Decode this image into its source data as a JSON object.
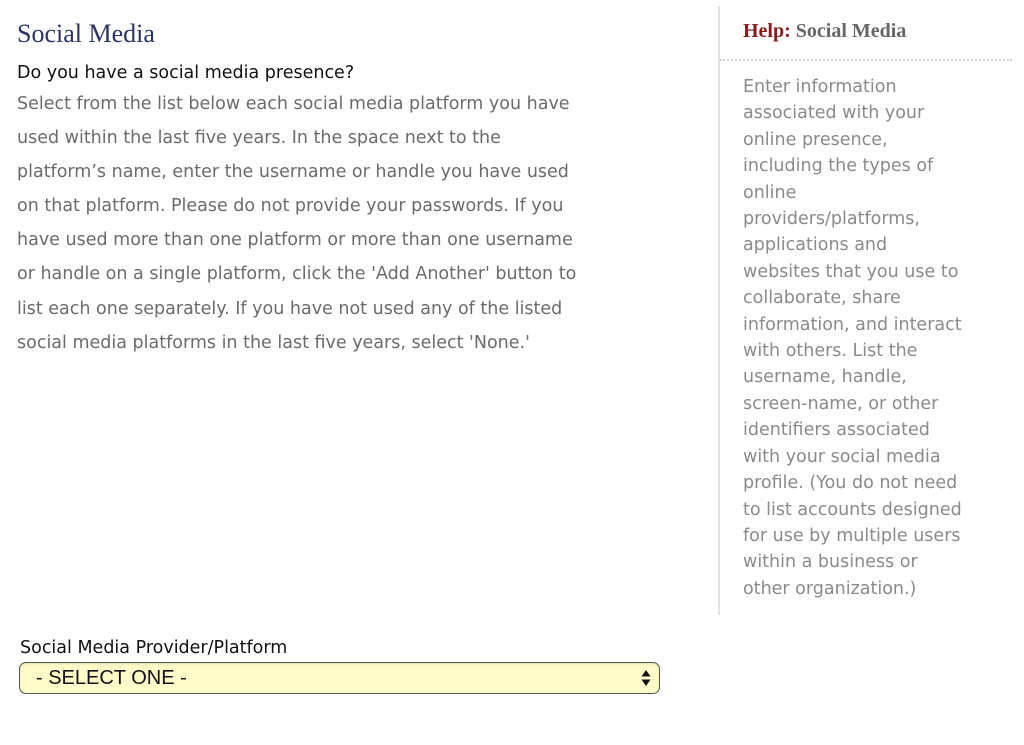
{
  "section": {
    "title": "Social Media",
    "question": "Do you have a social media presence?",
    "instructions_lines": [
      "Select from the list below each social media platform you have",
      "used within the last five years. In the space next to the",
      "platform’s name, enter the username or handle you have used",
      "on that platform. Please do not provide your passwords. If you",
      "have used more than one platform or more than one username",
      "or handle on a single platform, click the 'Add Another' button to",
      "list each one separately. If you have not used any of the listed",
      "social media platforms in the last five years, select 'None.'"
    ]
  },
  "help": {
    "label": "Help:",
    "topic": "Social Media",
    "text_lines": [
      "Enter information",
      "associated with your",
      "online presence,",
      "including the types of",
      "online",
      "providers/platforms,",
      "applications and",
      "websites that you use to",
      "collaborate, share",
      "information, and interact",
      "with others. List the",
      "username, handle,",
      "screen-name, or other",
      "identifiers associated",
      "with your social media",
      "profile. (You do not need",
      "to list accounts designed",
      "for use by multiple users",
      "within a business or",
      "other organization.)"
    ]
  },
  "form": {
    "platform_label": "Social Media Provider/Platform",
    "platform_select": {
      "selected": "- SELECT ONE -",
      "icon": "select-updown-arrows"
    }
  },
  "colors": {
    "title_navy": "#2b3566",
    "help_label_red": "#8b1a1a",
    "select_background": "#fefdc9"
  }
}
